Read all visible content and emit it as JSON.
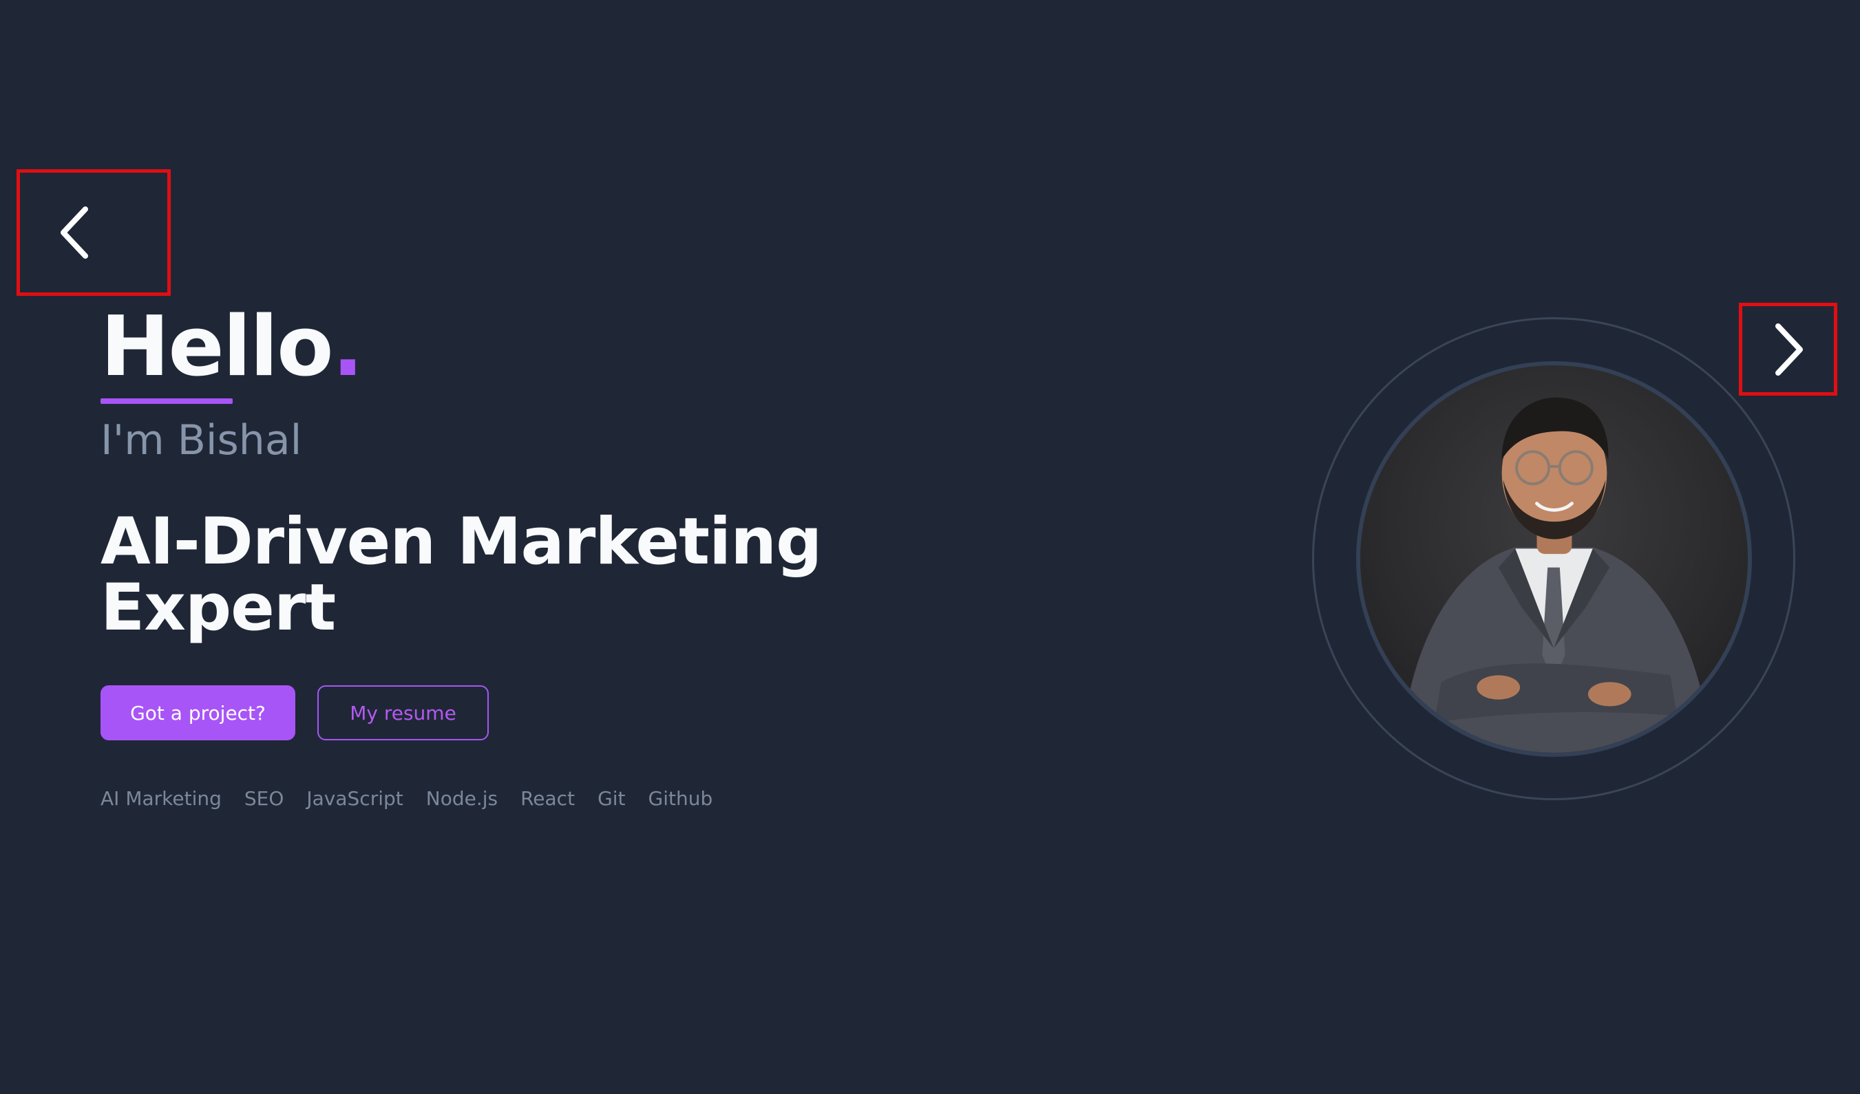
{
  "hero": {
    "greeting": "Hello",
    "greeting_dot": ".",
    "intro": "I'm Bishal",
    "headline_line1": "AI-Driven Marketing",
    "headline_line2": "Expert"
  },
  "buttons": {
    "primary_label": "Got a project?",
    "secondary_label": "My resume"
  },
  "skills": [
    "AI Marketing",
    "SEO",
    "JavaScript",
    "Node.js",
    "React",
    "Git",
    "Github"
  ],
  "navigation": {
    "prev_icon": "chevron-left-icon",
    "next_icon": "chevron-right-icon"
  },
  "colors": {
    "background": "#1f2736",
    "accent": "#a855f7",
    "text_primary": "#f8fafc",
    "text_muted": "#8795ab",
    "highlight_box": "#e10e12"
  }
}
